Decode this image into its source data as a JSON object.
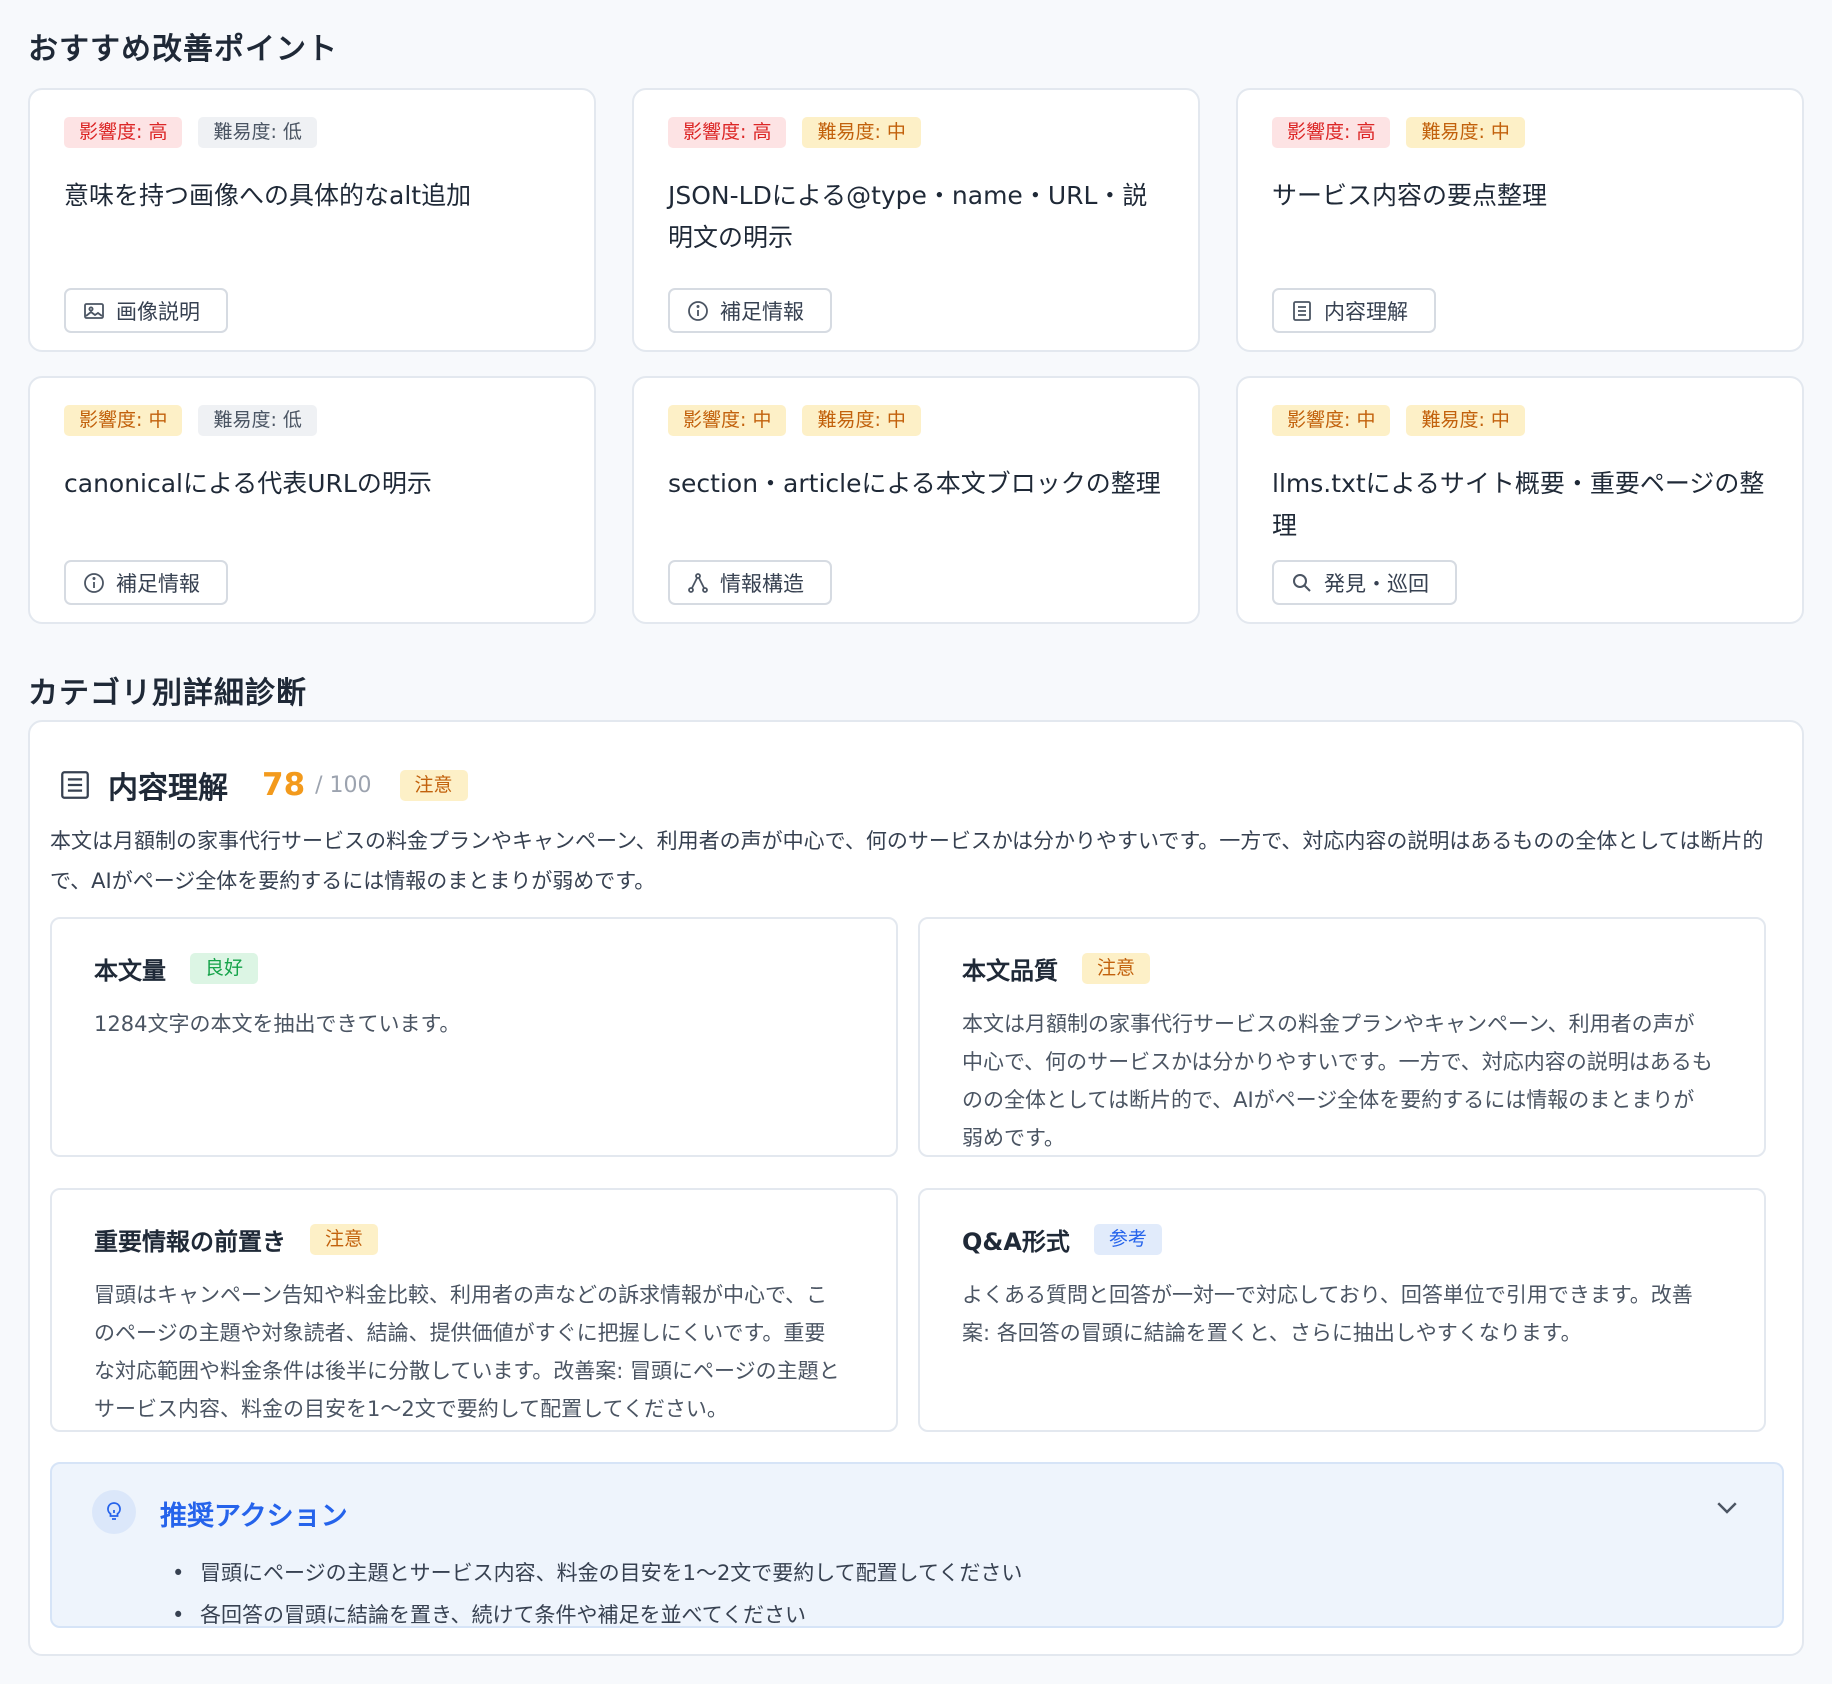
{
  "recommend": {
    "title": "おすすめ改善ポイント",
    "cards": [
      {
        "impact": "影響度: 高",
        "difficulty": "難易度: 低",
        "title": "意味を持つ画像への具体的なalt追加",
        "tag": "画像説明",
        "tag_icon": "image-icon"
      },
      {
        "impact": "影響度: 高",
        "difficulty": "難易度: 中",
        "title": "JSON-LDによる@type・name・URL・説明文の明示",
        "tag": "補足情報",
        "tag_icon": "info-icon"
      },
      {
        "impact": "影響度: 高",
        "difficulty": "難易度: 中",
        "title": "サービス内容の要点整理",
        "tag": "内容理解",
        "tag_icon": "document-icon"
      },
      {
        "impact": "影響度: 中",
        "difficulty": "難易度: 低",
        "title": "canonicalによる代表URLの明示",
        "tag": "補足情報",
        "tag_icon": "info-icon"
      },
      {
        "impact": "影響度: 中",
        "difficulty": "難易度: 中",
        "title": "section・articleによる本文ブロックの整理",
        "tag": "情報構造",
        "tag_icon": "structure-icon"
      },
      {
        "impact": "影響度: 中",
        "difficulty": "難易度: 中",
        "title": "llms.txtによるサイト概要・重要ページの整理",
        "tag": "発見・巡回",
        "tag_icon": "search-icon"
      }
    ]
  },
  "category": {
    "section_title": "カテゴリ別詳細診断",
    "name": "内容理解",
    "score": "78",
    "score_max": "/ 100",
    "status": "注意",
    "description": "本文は月額制の家事代行サービスの料金プランやキャンペーン、利用者の声が中心で、何のサービスかは分かりやすいです。一方で、対応内容の説明はあるものの全体としては断片的で、AIがページ全体を要約するには情報のまとまりが弱めです。",
    "items": [
      {
        "title": "本文量",
        "status": "良好",
        "text": "1284文字の本文を抽出できています。"
      },
      {
        "title": "本文品質",
        "status": "注意",
        "text": "本文は月額制の家事代行サービスの料金プランやキャンペーン、利用者の声が中心で、何のサービスかは分かりやすいです。一方で、対応内容の説明はあるものの全体としては断片的で、AIがページ全体を要約するには情報のまとまりが弱めです。"
      },
      {
        "title": "重要情報の前置き",
        "status": "注意",
        "text": "冒頭はキャンペーン告知や料金比較、利用者の声などの訴求情報が中心で、このページの主題や対象読者、結論、提供価値がすぐに把握しにくいです。重要な対応範囲や料金条件は後半に分散しています。改善案: 冒頭にページの主題とサービス内容、料金の目安を1〜2文で要約して配置してください。"
      },
      {
        "title": "Q&A形式",
        "status": "参考",
        "text": "よくある質問と回答が一対一で対応しており、回答単位で引用できます。改善案: 各回答の冒頭に結論を置くと、さらに抽出しやすくなります。"
      }
    ],
    "action": {
      "title": "推奨アクション",
      "items": [
        "冒頭にページの主題とサービス内容、料金の目安を1〜2文で要約して配置してください",
        "各回答の冒頭に結論を置き、続けて条件や補足を並べてください"
      ]
    }
  }
}
